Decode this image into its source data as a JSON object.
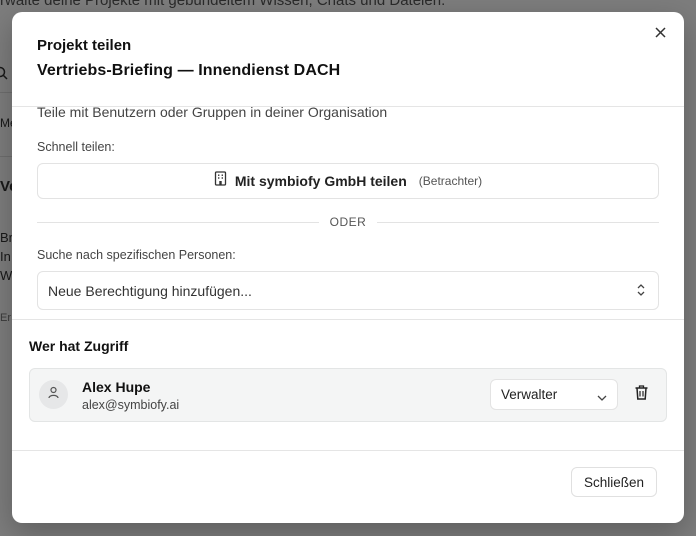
{
  "background": {
    "header_text": "rwalte deine Projekte mit gebündeltem Wissen, Chats und Dateien.",
    "fragments": [
      "Me",
      "Ve",
      "Br",
      "In",
      "W",
      "Er"
    ]
  },
  "dialog": {
    "title": "Projekt teilen",
    "project_name": "Vertriebs-Briefing — Innendienst DACH",
    "close_icon": "x-icon",
    "description": "Teile mit Benutzern oder Gruppen in deiner Organisation",
    "quick_share": {
      "label": "Schnell teilen:",
      "icon": "building-icon",
      "org_label": "Mit symbiofy GmbH teilen",
      "role": "(Betrachter)"
    },
    "divider_text": "ODER",
    "search": {
      "label": "Suche nach spezifischen Personen:",
      "placeholder": "Neue Berechtigung hinzufügen...",
      "icon": "chevrons-up-down-icon"
    },
    "access": {
      "title": "Wer hat Zugriff",
      "users": [
        {
          "name": "Alex Hupe",
          "email": "alex@symbiofy.ai",
          "role": "Verwalter",
          "avatar_icon": "user-icon",
          "remove_icon": "trash-icon"
        }
      ]
    },
    "footer": {
      "close_label": "Schließen"
    }
  },
  "colors": {
    "overlay": "#000000",
    "dialog_bg": "#ffffff",
    "border": "#e3e3e3",
    "row_bg": "#f4f5f5",
    "text": "#111111"
  }
}
